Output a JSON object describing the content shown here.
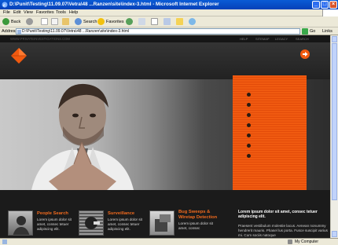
{
  "window": {
    "title": "D:\\Punit\\Testing\\11.09.07\\Vetra\\48 ...Ranzen\\site\\index-3.html - Microsoft Internet Explorer"
  },
  "menu": [
    "File",
    "Edit",
    "View",
    "Favorites",
    "Tools",
    "Help"
  ],
  "toolbar": {
    "back": "Back",
    "search": "Search",
    "favorites": "Favorites"
  },
  "address": {
    "label": "Address",
    "value": "D:\\Punit\\Testing\\11.09.07\\Vetra\\48 ...Ranzen\\site\\index-3.html",
    "go": "Go",
    "links": "Links"
  },
  "site": {
    "url_text": "WWW.PRIVATEINVESTIGATIONS.COM",
    "nav": [
      "HELP",
      "SITEMAP",
      "LEGACY",
      "SEARCH"
    ],
    "logo_icon": "diamond-logo-icon",
    "arrow_icon": "arrow-right-icon",
    "accent": "#f05a10"
  },
  "services": [
    {
      "title": "People Search",
      "text": "Lorem ipsum dolor sit amet, consec tetuer adipiscing elit."
    },
    {
      "title": "Surveillance",
      "text": "Lorem ipsum dolor sit amet, consec tetuer adipiscing elit."
    },
    {
      "title": "Bug Sweeps & Wiretap Detection",
      "text": "Lorem ipsum dolor sit amet, consec"
    }
  ],
  "lorem": {
    "heading": "Lorem ipsum dolor sit amet, consec tetuer adipiscing elit.",
    "text": "Praesent vestibulum molestie lacus. Aenean nonummy hendrerit mauris. Phasel lus porta. Fusce suscipit varius mi. Cum sociis natoque"
  },
  "status": {
    "zone": "My Computer"
  }
}
